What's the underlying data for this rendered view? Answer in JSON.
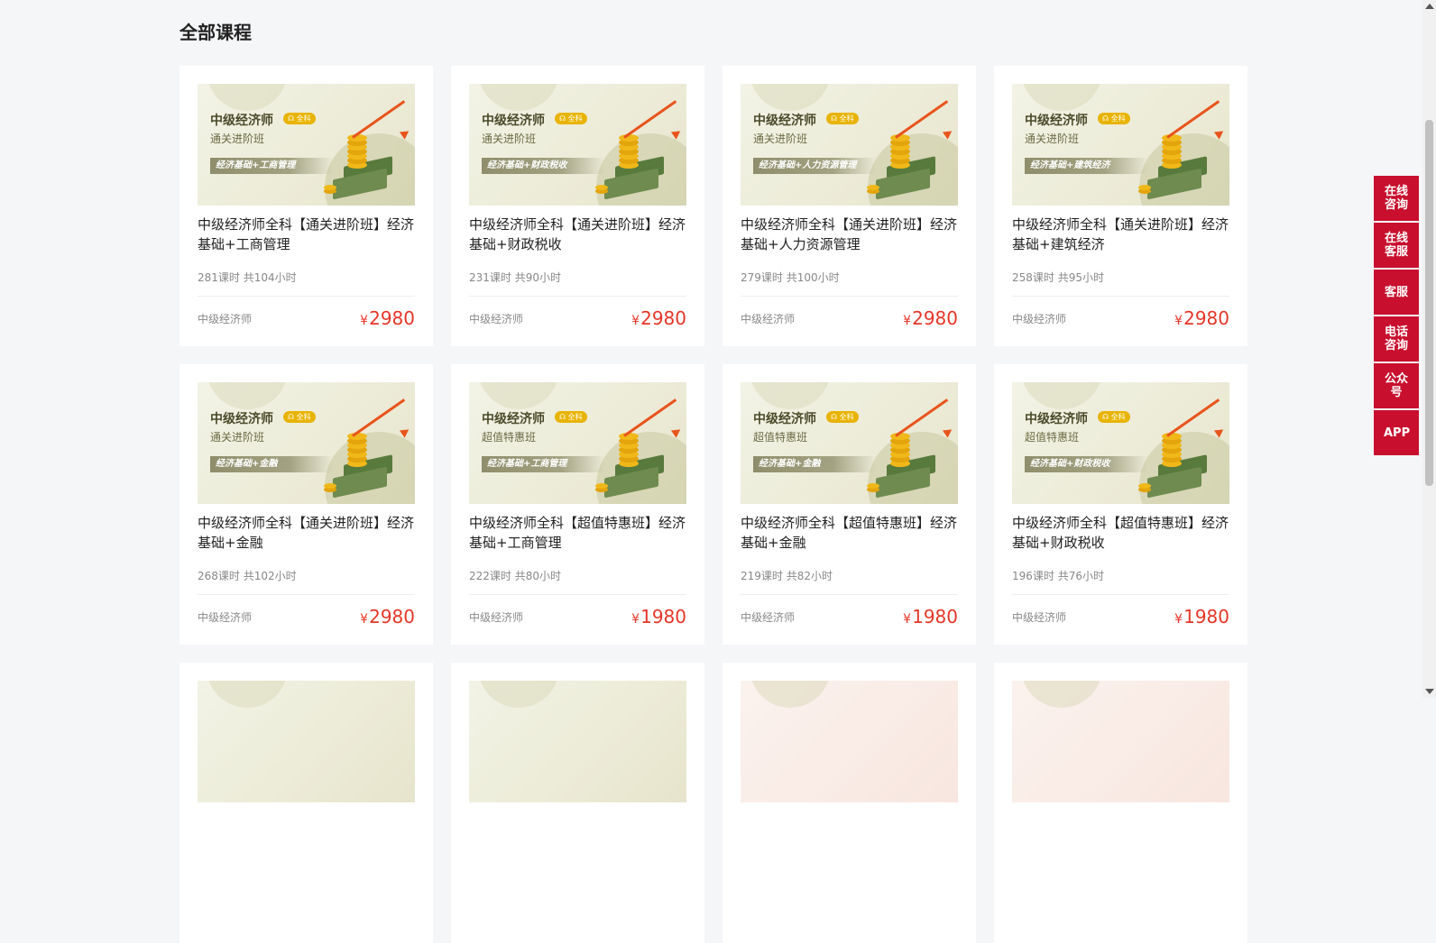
{
  "section": {
    "title": "全部课程"
  },
  "thumb": {
    "brand": "中级经济师",
    "tag": "全科",
    "tag_icon": "headphones-icon"
  },
  "courses": [
    {
      "class_name": "通关进阶班",
      "band": "经济基础+工商管理",
      "title": "中级经济师全科【通关进阶班】经济基础+工商管理",
      "meta": "281课时 共104小时",
      "category": "中级经济师",
      "currency": "¥",
      "price": "2980",
      "theme": "green"
    },
    {
      "class_name": "通关进阶班",
      "band": "经济基础+财政税收",
      "title": "中级经济师全科【通关进阶班】经济基础+财政税收",
      "meta": "231课时 共90小时",
      "category": "中级经济师",
      "currency": "¥",
      "price": "2980",
      "theme": "green"
    },
    {
      "class_name": "通关进阶班",
      "band": "经济基础+人力资源管理",
      "title": "中级经济师全科【通关进阶班】经济基础+人力资源管理",
      "meta": "279课时 共100小时",
      "category": "中级经济师",
      "currency": "¥",
      "price": "2980",
      "theme": "green"
    },
    {
      "class_name": "通关进阶班",
      "band": "经济基础+建筑经济",
      "title": "中级经济师全科【通关进阶班】经济基础+建筑经济",
      "meta": "258课时 共95小时",
      "category": "中级经济师",
      "currency": "¥",
      "price": "2980",
      "theme": "green"
    },
    {
      "class_name": "通关进阶班",
      "band": "经济基础+金融",
      "title": "中级经济师全科【通关进阶班】经济基础+金融",
      "meta": "268课时 共102小时",
      "category": "中级经济师",
      "currency": "¥",
      "price": "2980",
      "theme": "green"
    },
    {
      "class_name": "超值特惠班",
      "band": "经济基础+工商管理",
      "title": "中级经济师全科【超值特惠班】经济基础+工商管理",
      "meta": "222课时 共80小时",
      "category": "中级经济师",
      "currency": "¥",
      "price": "1980",
      "theme": "green"
    },
    {
      "class_name": "超值特惠班",
      "band": "经济基础+金融",
      "title": "中级经济师全科【超值特惠班】经济基础+金融",
      "meta": "219课时 共82小时",
      "category": "中级经济师",
      "currency": "¥",
      "price": "1980",
      "theme": "green"
    },
    {
      "class_name": "超值特惠班",
      "band": "经济基础+财政税收",
      "title": "中级经济师全科【超值特惠班】经济基础+财政税收",
      "meta": "196课时 共76小时",
      "category": "中级经济师",
      "currency": "¥",
      "price": "1980",
      "theme": "green"
    },
    {
      "theme": "green"
    },
    {
      "theme": "green"
    },
    {
      "theme": "pink"
    },
    {
      "theme": "pink"
    }
  ],
  "sidebar": {
    "items": [
      {
        "label": "在线咨询"
      },
      {
        "label": "在线客服"
      },
      {
        "label": "客服"
      },
      {
        "label": "电话咨询"
      },
      {
        "label": "公众号"
      },
      {
        "label": "APP"
      }
    ]
  },
  "colors": {
    "accent_red": "#c8102e",
    "price_red": "#e53628",
    "tag_yellow": "#e8b400"
  }
}
